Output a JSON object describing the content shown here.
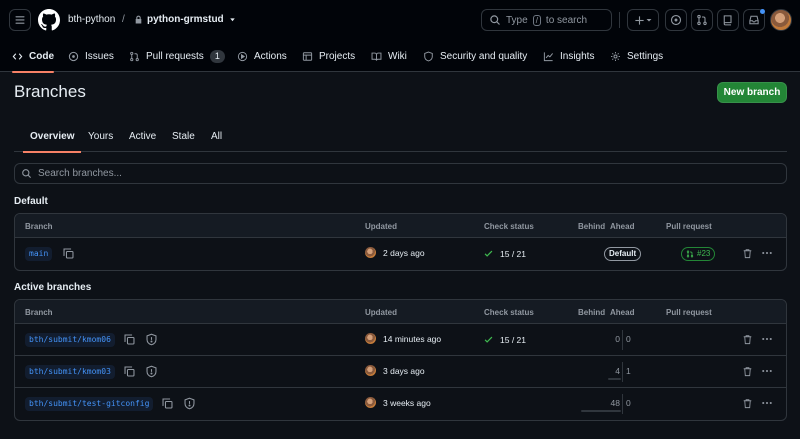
{
  "header": {
    "owner": "bth-python",
    "separator": "/",
    "repo": "python-grmstud",
    "search_label": "Type",
    "search_key": "/",
    "search_suffix": "to search"
  },
  "nav": {
    "tabs": [
      {
        "label": "Code",
        "icon": "code-icon"
      },
      {
        "label": "Issues",
        "icon": "issue-icon"
      },
      {
        "label": "Pull requests",
        "icon": "pull-request-icon",
        "count": "1"
      },
      {
        "label": "Actions",
        "icon": "play-icon"
      },
      {
        "label": "Projects",
        "icon": "table-icon"
      },
      {
        "label": "Wiki",
        "icon": "book-icon"
      },
      {
        "label": "Security and quality",
        "icon": "shield-icon"
      },
      {
        "label": "Insights",
        "icon": "graph-icon"
      },
      {
        "label": "Settings",
        "icon": "gear-icon"
      }
    ]
  },
  "page": {
    "title": "Branches",
    "new_branch_label": "New branch",
    "subtabs": [
      "Overview",
      "Yours",
      "Active",
      "Stale",
      "All"
    ],
    "search_placeholder": "Search branches..."
  },
  "columns": {
    "branch": "Branch",
    "updated": "Updated",
    "check_status": "Check status",
    "behind": "Behind",
    "ahead": "Ahead",
    "pull_request": "Pull request"
  },
  "default_section": {
    "heading": "Default",
    "rows": [
      {
        "name": "main",
        "updated": "2 days ago",
        "check": "15 / 21",
        "badge": "Default",
        "pr": "#23"
      }
    ]
  },
  "active_section": {
    "heading": "Active branches",
    "rows": [
      {
        "name": "bth/submit/kmom06",
        "updated": "14 minutes ago",
        "check": "15 / 21",
        "behind": "0",
        "ahead": "0"
      },
      {
        "name": "bth/submit/kmom03",
        "updated": "3 days ago",
        "check": "",
        "behind": "4",
        "ahead": "1"
      },
      {
        "name": "bth/submit/test-gitconfig",
        "updated": "3 weeks ago",
        "check": "",
        "behind": "48",
        "ahead": "0"
      }
    ]
  },
  "colors": {
    "accent": "#f78166",
    "link": "#4493f8",
    "success": "#3fb950",
    "button_green": "#238636"
  }
}
